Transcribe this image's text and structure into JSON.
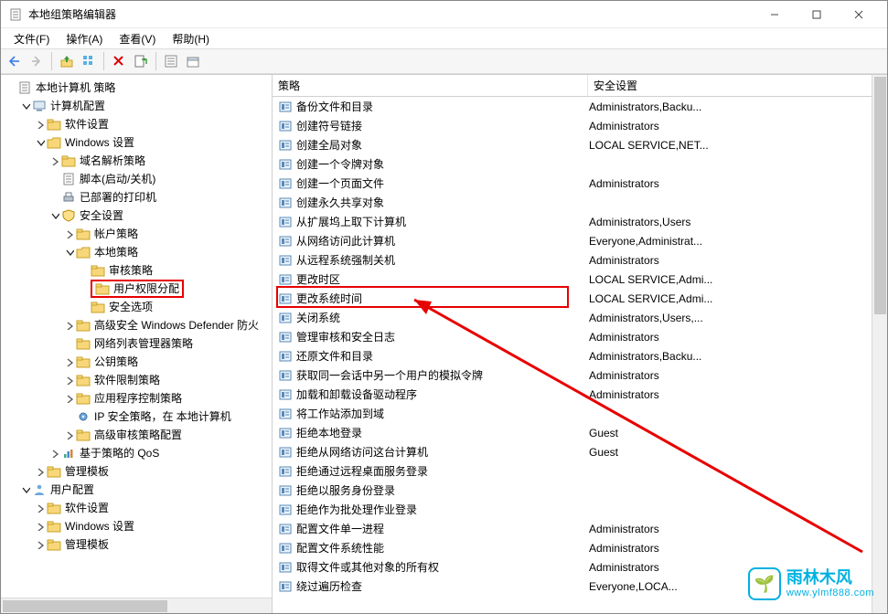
{
  "window": {
    "title": "本地组策略编辑器"
  },
  "menu": {
    "file": "文件(F)",
    "action": "操作(A)",
    "view": "查看(V)",
    "help": "帮助(H)"
  },
  "tree": {
    "root": "本地计算机 策略",
    "comp": "计算机配置",
    "sw1": "软件设置",
    "win1": "Windows 设置",
    "dns": "域名解析策略",
    "script": "脚本(启动/关机)",
    "printers": "已部署的打印机",
    "secset": "安全设置",
    "acct": "帐户策略",
    "local": "本地策略",
    "audit": "审核策略",
    "ura": "用户权限分配",
    "secopt": "安全选项",
    "defender": "高级安全 Windows Defender 防火",
    "nlm": "网络列表管理器策略",
    "pki": "公钥策略",
    "srp": "软件限制策略",
    "appctrl": "应用程序控制策略",
    "ipsec": "IP 安全策略，在 本地计算机",
    "advaudit": "高级审核策略配置",
    "qos": "基于策略的 QoS",
    "admtpl1": "管理模板",
    "user": "用户配置",
    "sw2": "软件设置",
    "win2": "Windows 设置",
    "admtpl2": "管理模板"
  },
  "cols": {
    "policy": "策略",
    "security": "安全设置"
  },
  "rows": [
    {
      "name": "备份文件和目录",
      "sec": "Administrators,Backu..."
    },
    {
      "name": "创建符号链接",
      "sec": "Administrators"
    },
    {
      "name": "创建全局对象",
      "sec": "LOCAL SERVICE,NET..."
    },
    {
      "name": "创建一个令牌对象",
      "sec": ""
    },
    {
      "name": "创建一个页面文件",
      "sec": "Administrators"
    },
    {
      "name": "创建永久共享对象",
      "sec": ""
    },
    {
      "name": "从扩展坞上取下计算机",
      "sec": "Administrators,Users"
    },
    {
      "name": "从网络访问此计算机",
      "sec": "Everyone,Administrat..."
    },
    {
      "name": "从远程系统强制关机",
      "sec": "Administrators"
    },
    {
      "name": "更改时区",
      "sec": "LOCAL SERVICE,Admi..."
    },
    {
      "name": "更改系统时间",
      "sec": "LOCAL SERVICE,Admi..."
    },
    {
      "name": "关闭系统",
      "sec": "Administrators,Users,..."
    },
    {
      "name": "管理审核和安全日志",
      "sec": "Administrators"
    },
    {
      "name": "还原文件和目录",
      "sec": "Administrators,Backu..."
    },
    {
      "name": "获取同一会话中另一个用户的模拟令牌",
      "sec": "Administrators"
    },
    {
      "name": "加载和卸载设备驱动程序",
      "sec": "Administrators"
    },
    {
      "name": "将工作站添加到域",
      "sec": ""
    },
    {
      "name": "拒绝本地登录",
      "sec": "Guest"
    },
    {
      "name": "拒绝从网络访问这台计算机",
      "sec": "Guest"
    },
    {
      "name": "拒绝通过远程桌面服务登录",
      "sec": ""
    },
    {
      "name": "拒绝以服务身份登录",
      "sec": ""
    },
    {
      "name": "拒绝作为批处理作业登录",
      "sec": ""
    },
    {
      "name": "配置文件单一进程",
      "sec": "Administrators"
    },
    {
      "name": "配置文件系统性能",
      "sec": "Administrators"
    },
    {
      "name": "取得文件或其他对象的所有权",
      "sec": "Administrators"
    },
    {
      "name": "绕过遍历检查",
      "sec": "Everyone,LOCA..."
    }
  ],
  "watermark": {
    "title": "雨林木风",
    "url": "www.ylmf888.com"
  }
}
